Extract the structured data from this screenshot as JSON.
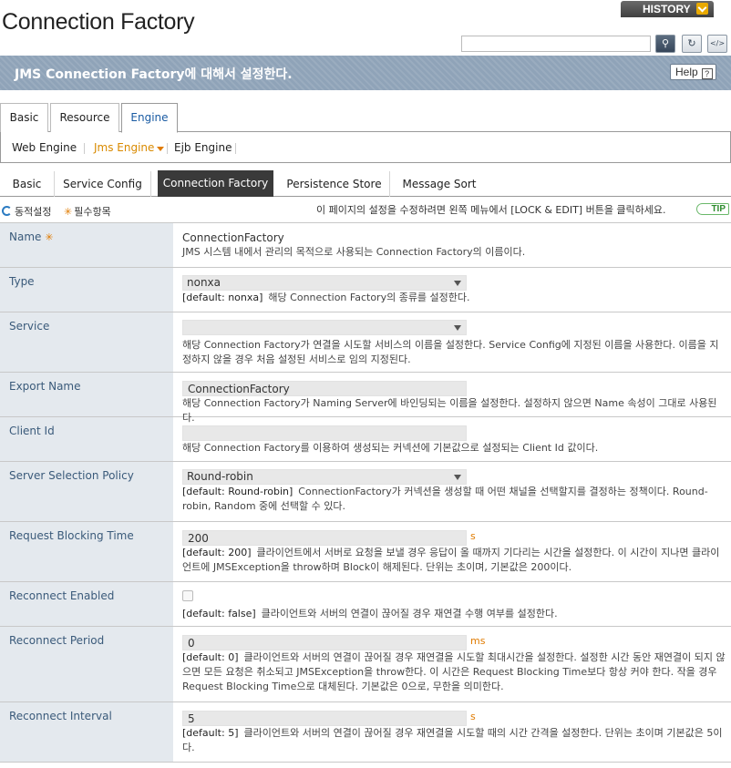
{
  "header": {
    "title": "Connection Factory",
    "history_label": "HISTORY",
    "search_placeholder": "",
    "banner_text": "JMS Connection Factory에 대해서 설정한다.",
    "help_label": "Help",
    "help_q": "?"
  },
  "top_tabs": [
    "Basic",
    "Resource",
    "Engine"
  ],
  "engine_nav": [
    "Web Engine",
    "Jms Engine",
    "Ejb Engine"
  ],
  "sub_tabs": [
    "Basic",
    "Service Config",
    "Connection Factory",
    "Persistence Store",
    "Message Sort"
  ],
  "legend": {
    "dynamic": "동적설정",
    "required": "필수항목",
    "notice": "이 페이지의 설정을 수정하려면 왼쪽 메뉴에서 [LOCK & EDIT] 버튼을 클릭하세요.",
    "tip": "TIP"
  },
  "fields": {
    "name": {
      "label": "Name",
      "value": "ConnectionFactory",
      "desc": "JMS 시스템 내에서 관리의 목적으로 사용되는 Connection Factory의 이름이다."
    },
    "type": {
      "label": "Type",
      "value": "nonxa",
      "default": "[default: nonxa]",
      "desc": "해당 Connection Factory의 종류를 설정한다."
    },
    "service": {
      "label": "Service",
      "value": "",
      "desc": "해당 Connection Factory가 연결을 시도할 서비스의 이름을 설정한다. Service Config에 지정된 이름을 사용한다. 이름을 지정하지 않을 경우 처음 설정된 서비스로 임의 지정된다."
    },
    "export_name": {
      "label": "Export Name",
      "value": "ConnectionFactory",
      "desc": "해당 Connection Factory가 Naming Server에 바인딩되는 이름을 설정한다. 설정하지 않으면 Name 속성이 그대로 사용된다."
    },
    "client_id": {
      "label": "Client Id",
      "value": "",
      "desc": "해당 Connection Factory를 이용하여 생성되는 커넥션에 기본값으로 설정되는 Client Id 값이다."
    },
    "server_selection_policy": {
      "label": "Server Selection Policy",
      "value": "Round-robin",
      "default": "[default: Round-robin]",
      "desc": "ConnectionFactory가 커넥션을 생성할 때 어떤 채널을 선택할지를 결정하는 정책이다. Round-robin, Random 중에 선택할 수 있다."
    },
    "request_blocking_time": {
      "label": "Request Blocking Time",
      "value": "200",
      "unit": "s",
      "default": "[default: 200]",
      "desc": "클라이언트에서 서버로 요청을 보낼 경우 응답이 올 때까지 기다리는 시간을 설정한다. 이 시간이 지나면 클라이언트에 JMSException을 throw하며 Block이 해제된다. 단위는 초이며, 기본값은 200이다."
    },
    "reconnect_enabled": {
      "label": "Reconnect Enabled",
      "default": "[default: false]",
      "desc": "클라이언트와 서버의 연결이 끊어질 경우 재연결 수행 여부를 설정한다."
    },
    "reconnect_period": {
      "label": "Reconnect Period",
      "value": "0",
      "unit": "ms",
      "default": "[default: 0]",
      "desc": "클라이언트와 서버의 연결이 끊어질 경우 재연결을 시도할 최대시간을 설정한다. 설정한 시간 동안 재연결이 되지 않으면 모든 요청은 취소되고 JMSException을 throw한다. 이 시간은 Request Blocking Time보다 항상 커야 한다. 작을 경우 Request Blocking Time으로 대체된다. 기본값은 0으로, 무한을 의미한다."
    },
    "reconnect_interval": {
      "label": "Reconnect Interval",
      "value": "5",
      "unit": "s",
      "default": "[default: 5]",
      "desc": "클라이언트와 서버의 연결이 끊어질 경우 재연결을 시도할 때의 시간 간격을 설정한다. 단위는 초이며 기본값은 5이다."
    }
  }
}
